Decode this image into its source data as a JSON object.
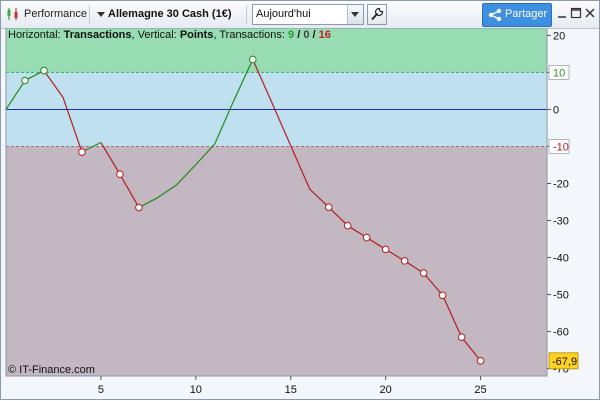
{
  "toolbar": {
    "performance_label": "Performance",
    "instrument_label": "Allemagne 30 Cash (1€)",
    "period_value": "Aujourd'hui",
    "share_label": "Partager"
  },
  "info": {
    "horizontal_label": "Horizontal:",
    "horizontal_value": "Transactions",
    "vertical_label": ", Vertical:",
    "vertical_value": "Points",
    "transactions_label": ", Transactions:",
    "win_count": "9",
    "sep1": " / ",
    "neutral_count": "0",
    "sep2": " / ",
    "loss_count": "16"
  },
  "copyright": "© IT-Finance.com",
  "colors": {
    "zone_positive": "#97dcb3",
    "zone_neutral": "#bfe0ee",
    "zone_negative": "#c3b7c1",
    "gain_line": "#1f8a1f",
    "loss_line": "#b31e1e",
    "zero_line": "#1a2fa0",
    "last_value_bg": "#ffd21f"
  },
  "chart_data": {
    "type": "line",
    "xlabel": "",
    "ylabel": "",
    "xlim": [
      0,
      28.5
    ],
    "ylim": [
      -72,
      22
    ],
    "x_ticks": [
      "5",
      "10",
      "15",
      "20",
      "25"
    ],
    "y_ticks": [
      "20",
      "10",
      "0",
      "-10",
      "-20",
      "-30",
      "-40",
      "-50",
      "-60",
      "-70"
    ],
    "upper_threshold": 10,
    "lower_threshold": -10,
    "last_value_label": "-67,9",
    "series": [
      {
        "x": [
          0,
          1,
          2,
          3,
          4,
          5,
          6,
          7,
          8,
          9,
          10,
          11,
          12,
          13,
          14,
          15,
          16,
          17,
          18,
          19,
          20,
          21,
          22,
          23,
          24,
          25
        ],
        "y": [
          0,
          7.8,
          10.5,
          3.3,
          -11.5,
          -8.9,
          -17.5,
          -26.5,
          -23.8,
          -20.3,
          -14.9,
          -9.3,
          2.4,
          13.5,
          1.9,
          -9.8,
          -21.5,
          -26.4,
          -31.4,
          -34.6,
          -37.8,
          -40.9,
          -44.2,
          -50.2,
          -61.5,
          -67.9
        ],
        "markers": [
          false,
          true,
          true,
          false,
          true,
          false,
          true,
          true,
          false,
          false,
          false,
          false,
          false,
          true,
          false,
          false,
          false,
          true,
          true,
          true,
          true,
          true,
          true,
          true,
          true,
          true
        ]
      }
    ]
  }
}
